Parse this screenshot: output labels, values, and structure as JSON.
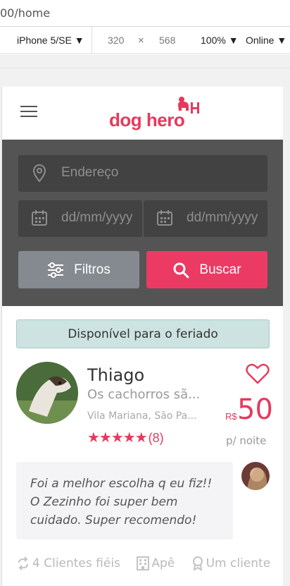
{
  "browser": {
    "url": "00/home",
    "device": "iPhone 5/SE",
    "width": "320",
    "times": "×",
    "height": "568",
    "zoom": "100%",
    "network": "Online"
  },
  "header": {
    "logo_text": "dog hero",
    "brand_color": "#e6395e"
  },
  "search": {
    "address_placeholder": "Endereço",
    "date_start_placeholder": "dd/mm/yyyy",
    "date_end_placeholder": "dd/mm/yyyy",
    "filter_label": "Filtros",
    "search_label": "Buscar"
  },
  "card": {
    "badge": "Disponível para o feriado",
    "name": "Thiago",
    "tagline": "Os cachorros sã...",
    "location": "Vila Mariana, São Pa...",
    "rating": "★★★★★",
    "review_count": "(8)",
    "currency": "R$",
    "price": "50",
    "per": "p/ noite",
    "review": "Foi a melhor escolha q eu fiz!! O Zezinho foi super bem cuidado. Super recomendo!",
    "features": [
      "4 Clientes fiéis",
      "Apê",
      "Um cliente"
    ]
  }
}
